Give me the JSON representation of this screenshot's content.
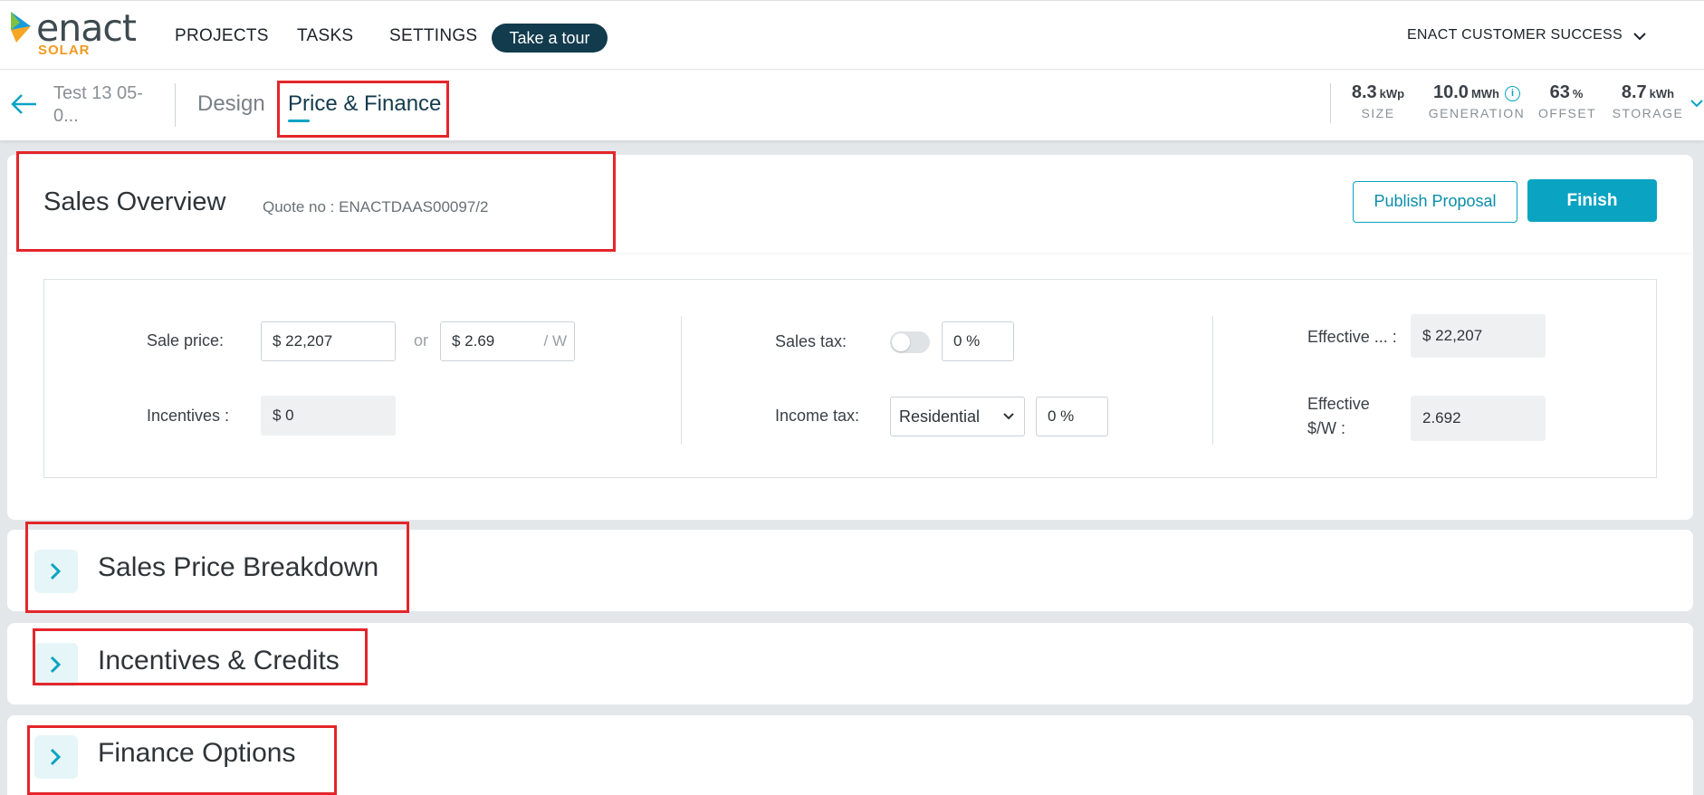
{
  "logo": {
    "word": "enact",
    "sub": "SOLAR"
  },
  "nav": {
    "projects": "PROJECTS",
    "tasks": "TASKS",
    "settings": "SETTINGS",
    "tour": "Take a tour",
    "account": "ENACT CUSTOMER SUCCESS"
  },
  "subnav": {
    "project_name": "Test 13 05-0...",
    "tabs": {
      "design": "Design",
      "price": "Price & Finance"
    },
    "stats": [
      {
        "value": "8.3",
        "unit": "kWp",
        "label": "SIZE"
      },
      {
        "value": "10.0",
        "unit": "MWh",
        "label": "GENERATION"
      },
      {
        "value": "63",
        "unit": "%",
        "label": "OFFSET"
      },
      {
        "value": "8.7",
        "unit": "kWh",
        "label": "STORAGE"
      }
    ]
  },
  "overview": {
    "title": "Sales Overview",
    "quote": "Quote no : ENACTDAAS00097/2",
    "publish": "Publish Proposal",
    "finish": "Finish",
    "sale_price_label": "Sale price:",
    "sale_price_value": "$  22,207",
    "or": "or",
    "per_watt_value": "$  2.69",
    "per_watt_suffix": "/ W",
    "incentives_label": "Incentives :",
    "incentives_value": "$ 0",
    "sales_tax_label": "Sales tax:",
    "sales_tax_value": "0 %",
    "income_tax_label": "Income tax:",
    "income_tax_type": "Residential",
    "income_tax_value": "0 %",
    "effective_label": "Effective ... :",
    "effective_value": "$ 22,207",
    "effective_w_label_1": "Effective",
    "effective_w_label_2": "$/W :",
    "effective_w_value": "2.692"
  },
  "sections": [
    {
      "title": "Sales Price Breakdown"
    },
    {
      "title": "Incentives & Credits"
    },
    {
      "title": "Finance Options"
    }
  ],
  "colors": {
    "accent": "#0aa3c2",
    "dark": "#123b4d",
    "highlight": "#e3262a"
  }
}
